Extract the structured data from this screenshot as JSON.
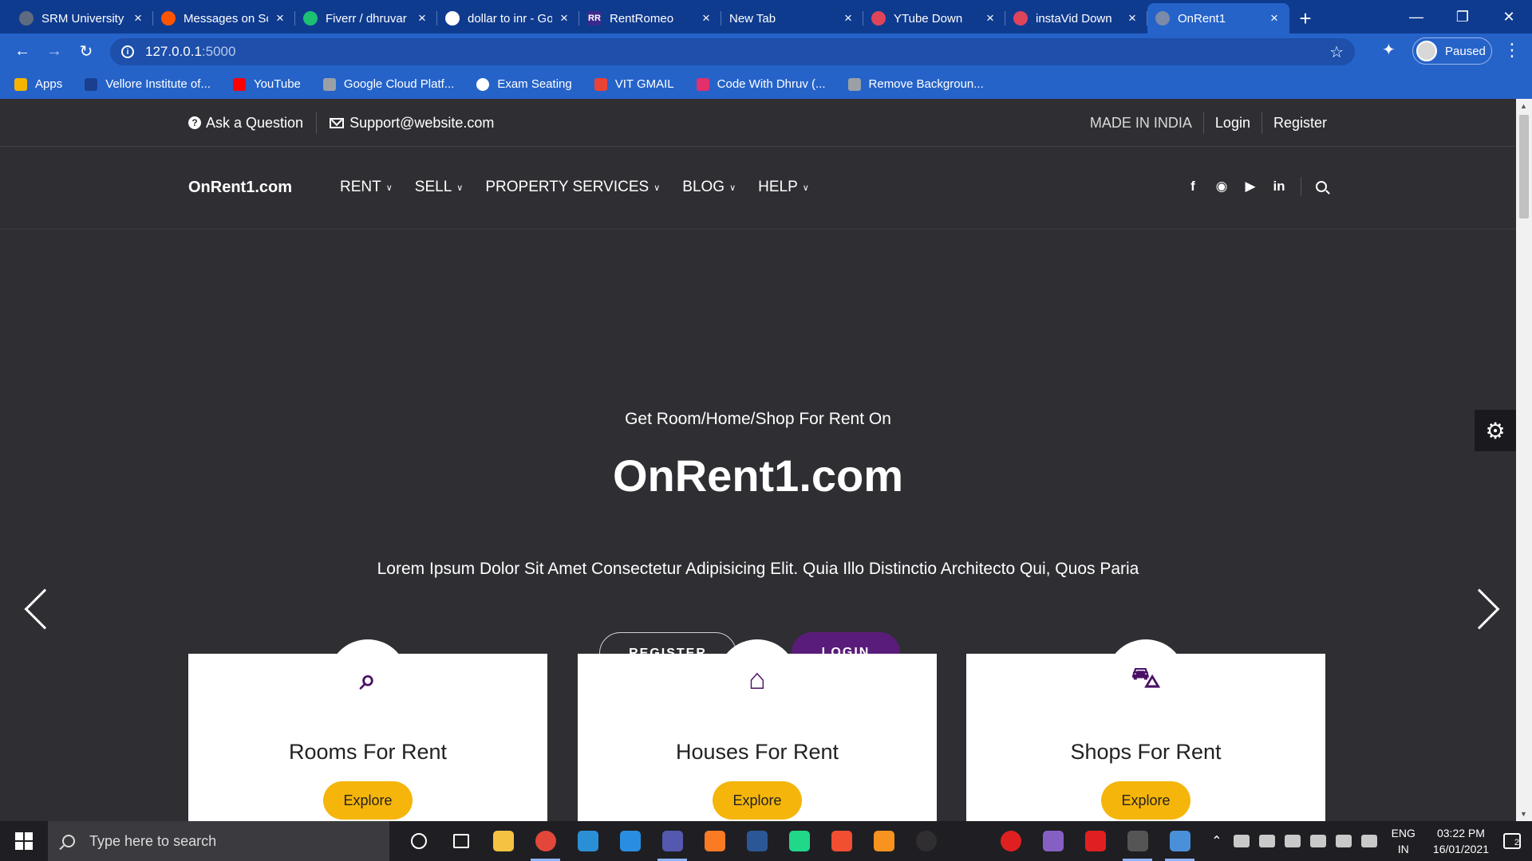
{
  "browser": {
    "tabs": [
      {
        "title": "SRM University",
        "icon": "globe-icon",
        "color": "#5f6b80"
      },
      {
        "title": "Messages on SoundCloud",
        "icon": "soundcloud-icon",
        "color": "#ff5500"
      },
      {
        "title": "Fiverr / dhruvar",
        "icon": "fiverr-icon",
        "color": "#1dbf73"
      },
      {
        "title": "dollar to inr - Google",
        "icon": "google-icon",
        "color": "#ffffff"
      },
      {
        "title": "RentRomeo",
        "icon": "rentromeo-icon",
        "color": "#3b2a8c",
        "glyph": "RR"
      },
      {
        "title": "New Tab",
        "icon": "",
        "color": ""
      },
      {
        "title": "YTube Down",
        "icon": "app-icon",
        "color": "#e0445b"
      },
      {
        "title": "instaVid Down",
        "icon": "app-icon",
        "color": "#e0445b"
      },
      {
        "title": "OnRent1",
        "icon": "globe-icon",
        "color": "#7a8aa8"
      }
    ],
    "tab_close_glyph": "×",
    "new_tab_glyph": "+",
    "url_host": "127.0.0.1",
    "url_port": ":5000",
    "profile_status": "Paused",
    "bookmarks": [
      {
        "label": "Apps",
        "icon": "apps-grid-icon",
        "color": "#f4b400"
      },
      {
        "label": "Vellore Institute of...",
        "icon": "vit-icon",
        "color": "#1a3f8f"
      },
      {
        "label": "YouTube",
        "icon": "youtube-icon",
        "color": "#ff0000"
      },
      {
        "label": "Google Cloud Platf...",
        "icon": "gcp-icon",
        "color": "#9aa0a6"
      },
      {
        "label": "Exam Seating",
        "icon": "globe-icon",
        "color": "#ffffff"
      },
      {
        "label": "VIT GMAIL",
        "icon": "gmail-icon",
        "color": "#ea4335"
      },
      {
        "label": "Code With Dhruv (...",
        "icon": "instagram-icon",
        "color": "#e1306c"
      },
      {
        "label": "Remove Backgroun...",
        "icon": "removebg-icon",
        "color": "#9aa0a6"
      }
    ]
  },
  "site": {
    "topbar": {
      "ask": "Ask a Question",
      "email": "Support@website.com",
      "made_in": "MADE IN INDIA",
      "login": "Login",
      "register": "Register"
    },
    "brand": "OnRent1.com",
    "menu": [
      "RENT",
      "SELL",
      "PROPERTY SERVICES",
      "BLOG",
      "HELP"
    ],
    "social_icons": [
      "facebook-icon",
      "instagram-icon",
      "youtube-icon",
      "linkedin-icon"
    ],
    "hero": {
      "kicker": "Get Room/Home/Shop For Rent On",
      "title": "OnRent1.com",
      "description": "Lorem Ipsum Dolor Sit Amet Consectetur Adipisicing Elit. Quia Illo Distinctio Architecto Qui, Quos Paria",
      "register_btn": "REGISTER",
      "login_btn": "LOGIN"
    },
    "accent": "#5a1c7a",
    "cards": [
      {
        "title": "Rooms For Rent",
        "button": "Explore",
        "icon": "search-icon"
      },
      {
        "title": "Houses For Rent",
        "button": "Explore",
        "icon": "home-icon"
      },
      {
        "title": "Shops For Rent",
        "button": "Explore",
        "icon": "cart-icon"
      }
    ],
    "explore_color": "#f5b50a"
  },
  "taskbar": {
    "search_placeholder": "Type here to search",
    "apps": [
      {
        "icon": "cortana-icon",
        "color": "#1f1f23"
      },
      {
        "icon": "task-view-icon",
        "color": "#1f1f23"
      },
      {
        "icon": "file-explorer-icon",
        "color": "#f5c242"
      },
      {
        "icon": "chrome-icon",
        "color": "#e2473a",
        "running": true
      },
      {
        "icon": "app-icon",
        "color": "#2b8fd6"
      },
      {
        "icon": "vscode-icon",
        "color": "#2a8ee0"
      },
      {
        "icon": "teams-icon",
        "color": "#5558af",
        "running": true
      },
      {
        "icon": "xampp-icon",
        "color": "#fb7a24"
      },
      {
        "icon": "word-icon",
        "color": "#2b5797"
      },
      {
        "icon": "pycharm-icon",
        "color": "#21d789"
      },
      {
        "icon": "git-icon",
        "color": "#f14e32"
      },
      {
        "icon": "fl-studio-icon",
        "color": "#f7931e"
      },
      {
        "icon": "obs-icon",
        "color": "#302e31"
      },
      {
        "icon": "unity-icon",
        "color": "#1f1f23"
      },
      {
        "icon": "media-player-icon",
        "color": "#e02020"
      },
      {
        "icon": "visual-studio-icon",
        "color": "#865fc5"
      },
      {
        "icon": "recorder-icon",
        "color": "#e02020"
      },
      {
        "icon": "app-icon",
        "color": "#555555",
        "running": true
      },
      {
        "icon": "paint-icon",
        "color": "#4a90d9",
        "running": true
      }
    ],
    "lang_top": "ENG",
    "lang_bottom": "IN",
    "time": "03:22 PM",
    "date": "16/01/2021",
    "notifications": "2"
  }
}
